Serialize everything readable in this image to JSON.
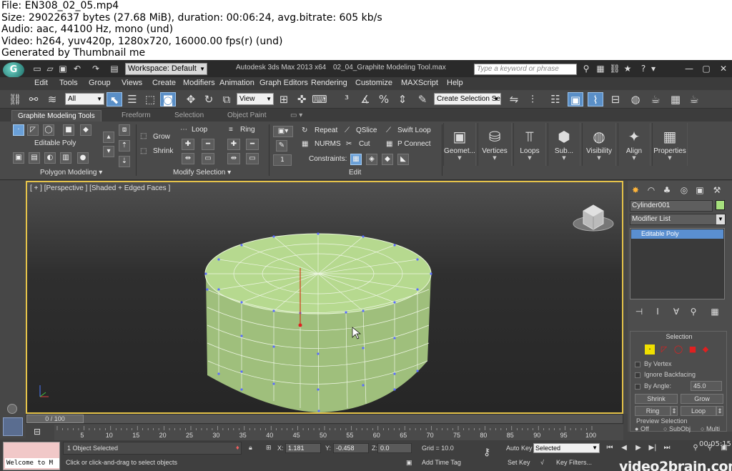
{
  "info": {
    "line1": "File: EN308_02_05.mp4",
    "line2": "Size: 29022637 bytes (27.68 MiB), duration: 00:06:24, avg.bitrate: 605 kb/s",
    "line3": "Audio: aac, 44100 Hz, mono (und)",
    "line4": "Video: h264, yuv420p, 1280x720, 16000.00 fps(r) (und)",
    "line5": "Generated by Thumbnail me"
  },
  "titlebar": {
    "workspace": "Workspace: Default",
    "app_title": "Autodesk 3ds Max  2013 x64",
    "file_title": "02_04_Graphite Modeling Tool.max",
    "search_placeholder": "Type a keyword or phrase"
  },
  "menu": [
    "Edit",
    "Tools",
    "Group",
    "Views",
    "Create",
    "Modifiers",
    "Animation",
    "Graph Editors",
    "Rendering",
    "Customize",
    "MAXScript",
    "Help"
  ],
  "toolbar": {
    "filter": "All",
    "ref_coord": "View",
    "selection_set": "Create Selection Se"
  },
  "ribbon": {
    "tabs": [
      "Graphite Modeling Tools",
      "Freeform",
      "Selection",
      "Object Paint"
    ],
    "editable_poly": "Editable Poly",
    "polygon_modeling": "Polygon Modeling",
    "grow": "Grow",
    "shrink": "Shrink",
    "loop": "Loop",
    "ring": "Ring",
    "modify_selection": "Modify Selection",
    "repeat": "Repeat",
    "qslice": "QSlice",
    "swift_loop": "Swift Loop",
    "nurms": "NURMS",
    "cut": "Cut",
    "p_connect": "P Connect",
    "constraints": "Constraints:",
    "edit": "Edit",
    "spinner_value": "1",
    "panels": [
      "Geomet...",
      "Vertices",
      "Loops",
      "Sub...",
      "Visibility",
      "Align",
      "Properties"
    ]
  },
  "viewport": {
    "label": "[ + ] [Perspective ] [Shaded + Edged Faces ]"
  },
  "command_panel": {
    "object_name": "Cylinder001",
    "modifier_list": "Modifier List",
    "stack_item": "Editable Poly",
    "selection_title": "Selection",
    "by_vertex": "By Vertex",
    "ignore_backfacing": "Ignore Backfacing",
    "by_angle": "By Angle:",
    "angle_value": "45.0",
    "shrink": "Shrink",
    "grow": "Grow",
    "ring": "Ring",
    "loop": "Loop",
    "preview_selection": "Preview Selection",
    "off": "Off",
    "subobj": "SubObj",
    "multi": "Multi"
  },
  "timeline": {
    "slider": "0 / 100",
    "ticks": [
      "5",
      "10",
      "15",
      "20",
      "25",
      "30",
      "35",
      "40",
      "45",
      "50",
      "55",
      "60",
      "65",
      "70",
      "75",
      "80",
      "85",
      "90",
      "95",
      "100"
    ]
  },
  "status": {
    "maxscript": "Welcome to M",
    "selected": "1 Object Selected",
    "prompt": "Click or click-and-drag to select objects",
    "x_label": "X:",
    "x": "1.181",
    "y_label": "Y:",
    "y": "-0.458",
    "z_label": "Z:",
    "z": "0.0",
    "grid": "Grid = 10.0",
    "add_time_tag": "Add Time Tag",
    "auto_key": "Auto Key",
    "set_key": "Set Key",
    "key_mode": "Selected",
    "key_filters": "Key Filters...",
    "watermark": "video2brain.com",
    "timecode": "00:05:15"
  }
}
